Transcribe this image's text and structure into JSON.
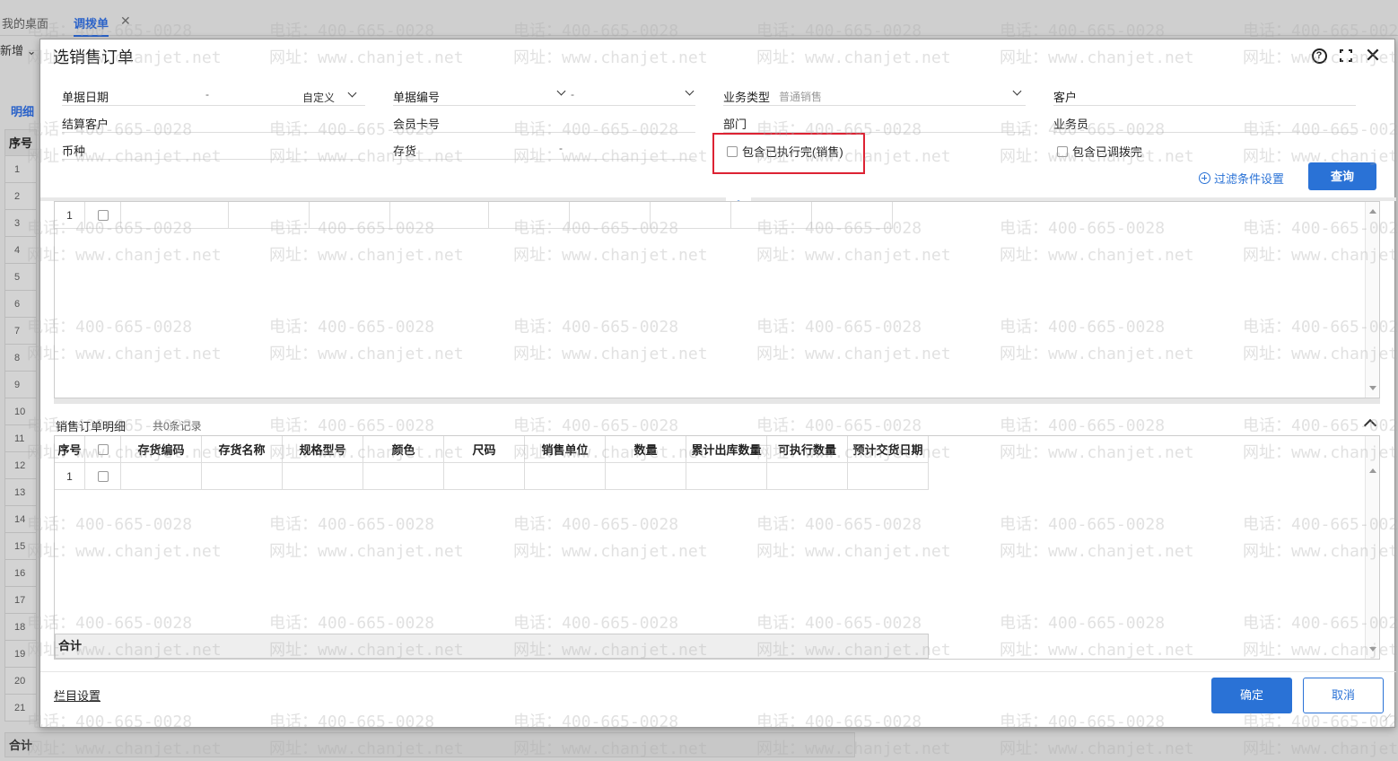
{
  "background": {
    "tabs": [
      {
        "label": "我的桌面",
        "active": false
      },
      {
        "label": "调拨单",
        "active": true
      }
    ],
    "new_label": "新增",
    "detail_tab": "明细",
    "row_header": "序号",
    "row_numbers": [
      "1",
      "2",
      "3",
      "4",
      "5",
      "6",
      "7",
      "8",
      "9",
      "10",
      "11",
      "12",
      "13",
      "14",
      "15",
      "16",
      "17",
      "18",
      "19",
      "20",
      "21"
    ],
    "total_label": "合计"
  },
  "dialog": {
    "title": "选销售订单",
    "filters": {
      "doc_date_label": "单据日期",
      "doc_date_sep": "-",
      "doc_date_mode": "自定义",
      "doc_no_label": "单据编号",
      "doc_no_sep": "-",
      "biz_type_label": "业务类型",
      "biz_type_value": "普通销售",
      "customer_label": "客户",
      "settle_customer_label": "结算客户",
      "member_card_label": "会员卡号",
      "dept_label": "部门",
      "salesman_label": "业务员",
      "currency_label": "币种",
      "inventory_label": "存货",
      "inventory_sep": "-",
      "include_executed_label": "包含已执行完(销售)",
      "include_transferred_label": "包含已调拨完",
      "filter_settings_label": "过滤条件设置",
      "query_button": "查询"
    },
    "top_grid": {
      "rows": [
        {
          "no": "1"
        }
      ]
    },
    "detail": {
      "title": "销售订单明细",
      "count": "共0条记录",
      "columns": [
        "序号",
        "",
        "存货编码",
        "存货名称",
        "规格型号",
        "颜色",
        "尺码",
        "销售单位",
        "数量",
        "累计出库数量",
        "可执行数量",
        "预计交货日期"
      ],
      "rows": [
        {
          "no": "1"
        }
      ],
      "total_label": "合计"
    },
    "footer": {
      "column_settings": "栏目设置",
      "confirm": "确定",
      "cancel": "取消"
    }
  },
  "watermark": {
    "phone": "电话：400-665-0028",
    "site": "网址：www.chanjet.net"
  },
  "colors": {
    "accent": "#2a72d6",
    "highlight": "#dd2233"
  }
}
